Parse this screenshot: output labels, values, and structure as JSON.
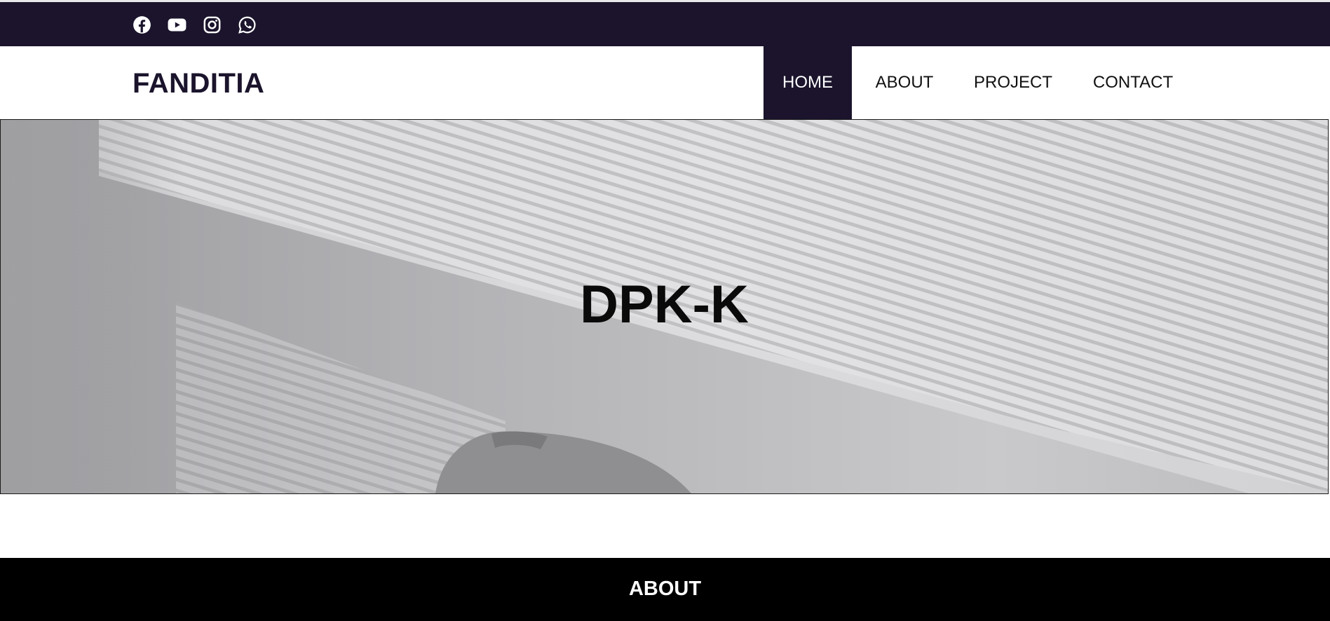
{
  "social": {
    "icons": [
      "facebook-icon",
      "youtube-icon",
      "instagram-icon",
      "whatsapp-icon"
    ]
  },
  "header": {
    "brand": "FANDITIA"
  },
  "nav": {
    "home": "HOME",
    "about": "ABOUT",
    "project": "PROJECT",
    "contact": "CONTACT",
    "active": "home"
  },
  "hero": {
    "title": "DPK-K"
  },
  "about": {
    "title": "ABOUT"
  },
  "colors": {
    "brand_dark": "#1b142c",
    "band": "#000000",
    "text_light": "#ffffff"
  }
}
